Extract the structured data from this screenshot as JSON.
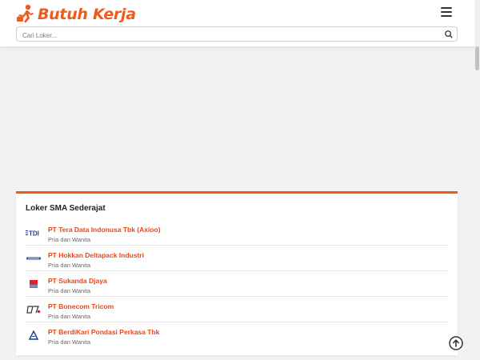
{
  "header": {
    "logo_text": "Butuh Kerja",
    "logo_icon": "runner-briefcase-icon",
    "menu_icon": "hamburger-menu-icon"
  },
  "search": {
    "placeholder": "Cari Loker...",
    "value": "",
    "icon": "search-icon"
  },
  "card": {
    "title": "Loker SMA Sederajat",
    "items": [
      {
        "company": "PT Tera Data Indonusa Tbk (Axioo)",
        "gender": "Pria dan Wanita",
        "logo_text": "TDI"
      },
      {
        "company": "PT Hokkan Deltapack Industri",
        "gender": "Pria dan Wanita",
        "logo_text": ""
      },
      {
        "company": "PT Sukanda Djaya",
        "gender": "Pria dan Wanita",
        "logo_text": ""
      },
      {
        "company": "PT Bonecom Tricom",
        "gender": "Pria dan Wanita",
        "logo_text": ""
      },
      {
        "company": "PT BerdiKari Pondasi Perkasa Tbk",
        "gender": "Pria dan Wanita",
        "logo_text": ""
      }
    ]
  },
  "colors": {
    "accent": "#f05a1a",
    "link": "#e8461b",
    "background": "#f2f2f4"
  },
  "scroll_top_icon": "arrow-up-circle-icon"
}
